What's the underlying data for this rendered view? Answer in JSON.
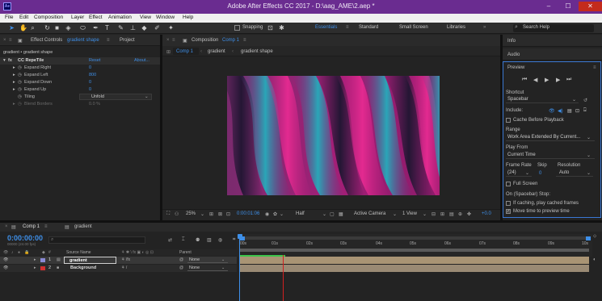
{
  "titlebar": {
    "app_icon": "Ae",
    "title": "Adobe After Effects CC 2017 - D:\\aag_AME\\2.aep *",
    "min": "–",
    "max": "☐",
    "close": "✕"
  },
  "menu": [
    "File",
    "Edit",
    "Composition",
    "Layer",
    "Effect",
    "Animation",
    "View",
    "Window",
    "Help"
  ],
  "toolbar": {
    "snapping_label": "Snapping",
    "workspaces": [
      "Essentials",
      "Standard",
      "Small Screen",
      "Libraries"
    ],
    "search_placeholder": "Search Help"
  },
  "effect_controls": {
    "tab_label": "Effect Controls",
    "tab_layer": "gradient shape",
    "project_tab": "Project",
    "breadcrumb": "gradient • gradient shape",
    "effect_name": "CC RepeTile",
    "reset": "Reset",
    "about": "About...",
    "props": [
      {
        "label": "Expand Right",
        "value": "0"
      },
      {
        "label": "Expand Left",
        "value": "800"
      },
      {
        "label": "Expand Down",
        "value": "0"
      },
      {
        "label": "Expand Up",
        "value": "0"
      },
      {
        "label": "Tiling",
        "value": "Unfold"
      },
      {
        "label": "Blend Borders",
        "value": "0.0 %"
      }
    ]
  },
  "composition": {
    "tab_label": "Composition",
    "tab_comp": "Comp 1",
    "crumbs": [
      "Comp 1",
      "gradient",
      "gradient shape"
    ],
    "footer": {
      "zoom": "25%",
      "timecode": "0:00:01:06",
      "resolution": "Half",
      "camera": "Active Camera",
      "views": "1 View",
      "exposure": "+0.0"
    }
  },
  "right_panel": {
    "info": "Info",
    "audio": "Audio",
    "preview": "Preview",
    "shortcut_label": "Shortcut",
    "shortcut_value": "Spacebar",
    "include_label": "Include:",
    "cache_before": "Cache Before Playback",
    "range_label": "Range",
    "range_value": "Work Area Extended By Current...",
    "play_from_label": "Play From",
    "play_from_value": "Current Time",
    "frame_rate_label": "Frame Rate",
    "frame_rate_value": "(24)",
    "skip_label": "Skip",
    "skip_value": "0",
    "resolution_label": "Resolution",
    "resolution_value": "Auto",
    "full_screen": "Full Screen",
    "stop_label": "On (Spacebar) Stop:",
    "if_caching": "If caching, play cached frames",
    "move_time": "Move time to preview time"
  },
  "timeline": {
    "tab_comp": "Comp 1",
    "tab_gradient": "gradient",
    "timecode": "0:00:00:00",
    "timecode_sub": "00000 (24.00 fps)",
    "col_source": "Source Name",
    "col_parent": "Parent",
    "layers": [
      {
        "num": "1",
        "name": "gradient",
        "parent": "None",
        "color": "#8a8ad6"
      },
      {
        "num": "2",
        "name": "Background",
        "parent": "None",
        "color": "#d23030"
      }
    ],
    "ruler": [
      "00s",
      "01s",
      "02s",
      "03s",
      "04s",
      "05s",
      "06s",
      "07s",
      "08s",
      "09s",
      "10s"
    ]
  }
}
